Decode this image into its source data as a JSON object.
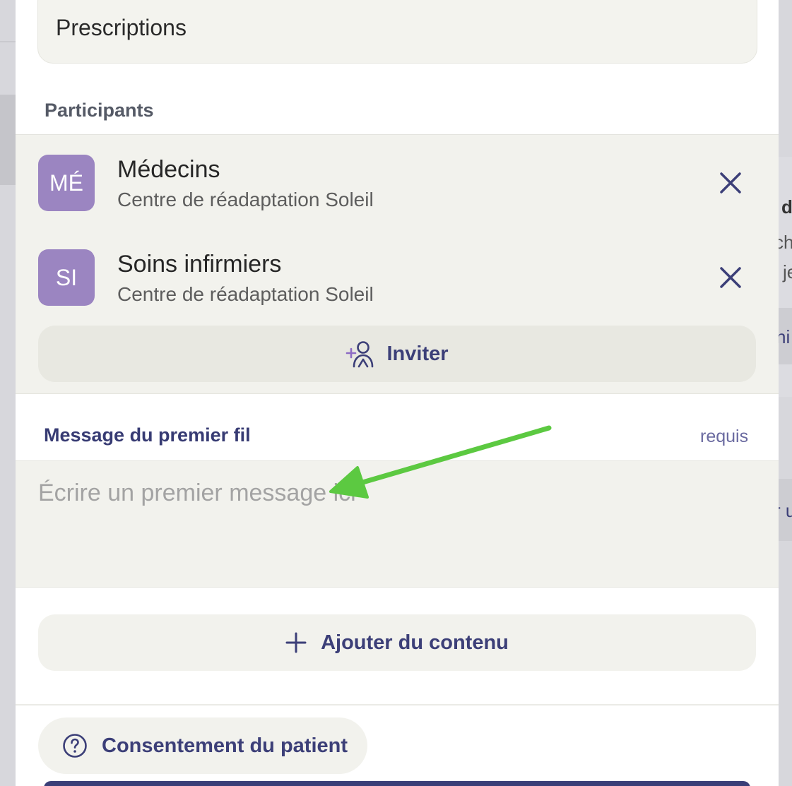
{
  "background": {
    "fragments": [
      "d",
      "ch",
      "je",
      "ni",
      "r u"
    ]
  },
  "form": {
    "type_field_value": "Prescriptions"
  },
  "participants": {
    "section_title": "Participants",
    "items": [
      {
        "initials": "MÉ",
        "name": "Médecins",
        "organization": "Centre de réadaptation Soleil",
        "remove_icon": "close-icon"
      },
      {
        "initials": "SI",
        "name": "Soins infirmiers",
        "organization": "Centre de réadaptation Soleil",
        "remove_icon": "close-icon"
      }
    ],
    "invite_label": "Inviter",
    "invite_icon": "add-user-icon"
  },
  "message": {
    "label": "Message du premier fil",
    "required_label": "requis",
    "placeholder": "Écrire un premier message ici",
    "value": ""
  },
  "actions": {
    "add_content_label": "Ajouter du contenu",
    "add_content_icon": "plus-icon",
    "consent_label": "Consentement du patient",
    "consent_icon": "help-circle-icon"
  },
  "colors": {
    "accent": "#3c3f78",
    "avatar": "#9b85c1",
    "panel": "#f2f2ed",
    "annotation_arrow": "#5cc941"
  }
}
